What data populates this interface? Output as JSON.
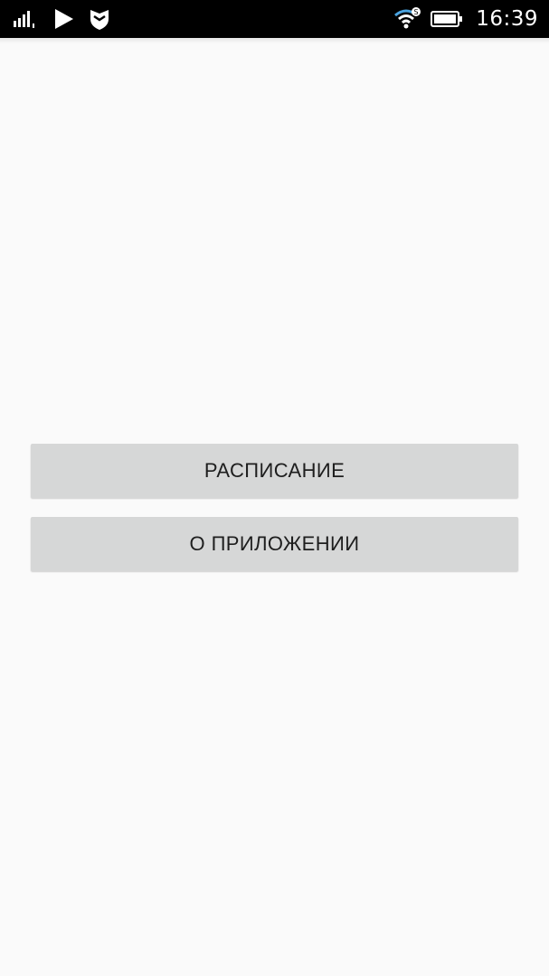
{
  "status_bar": {
    "time": "16:39",
    "icons": [
      "signal-icon",
      "play-store-icon",
      "shield-icon",
      "wifi-icon",
      "battery-icon"
    ]
  },
  "main": {
    "buttons": [
      {
        "label": "РАСПИСАНИЕ"
      },
      {
        "label": "О ПРИЛОЖЕНИИ"
      }
    ]
  },
  "colors": {
    "background": "#fafafa",
    "status_bar": "#000000",
    "button": "#d6d7d7",
    "button_text": "#1e1e1e"
  }
}
